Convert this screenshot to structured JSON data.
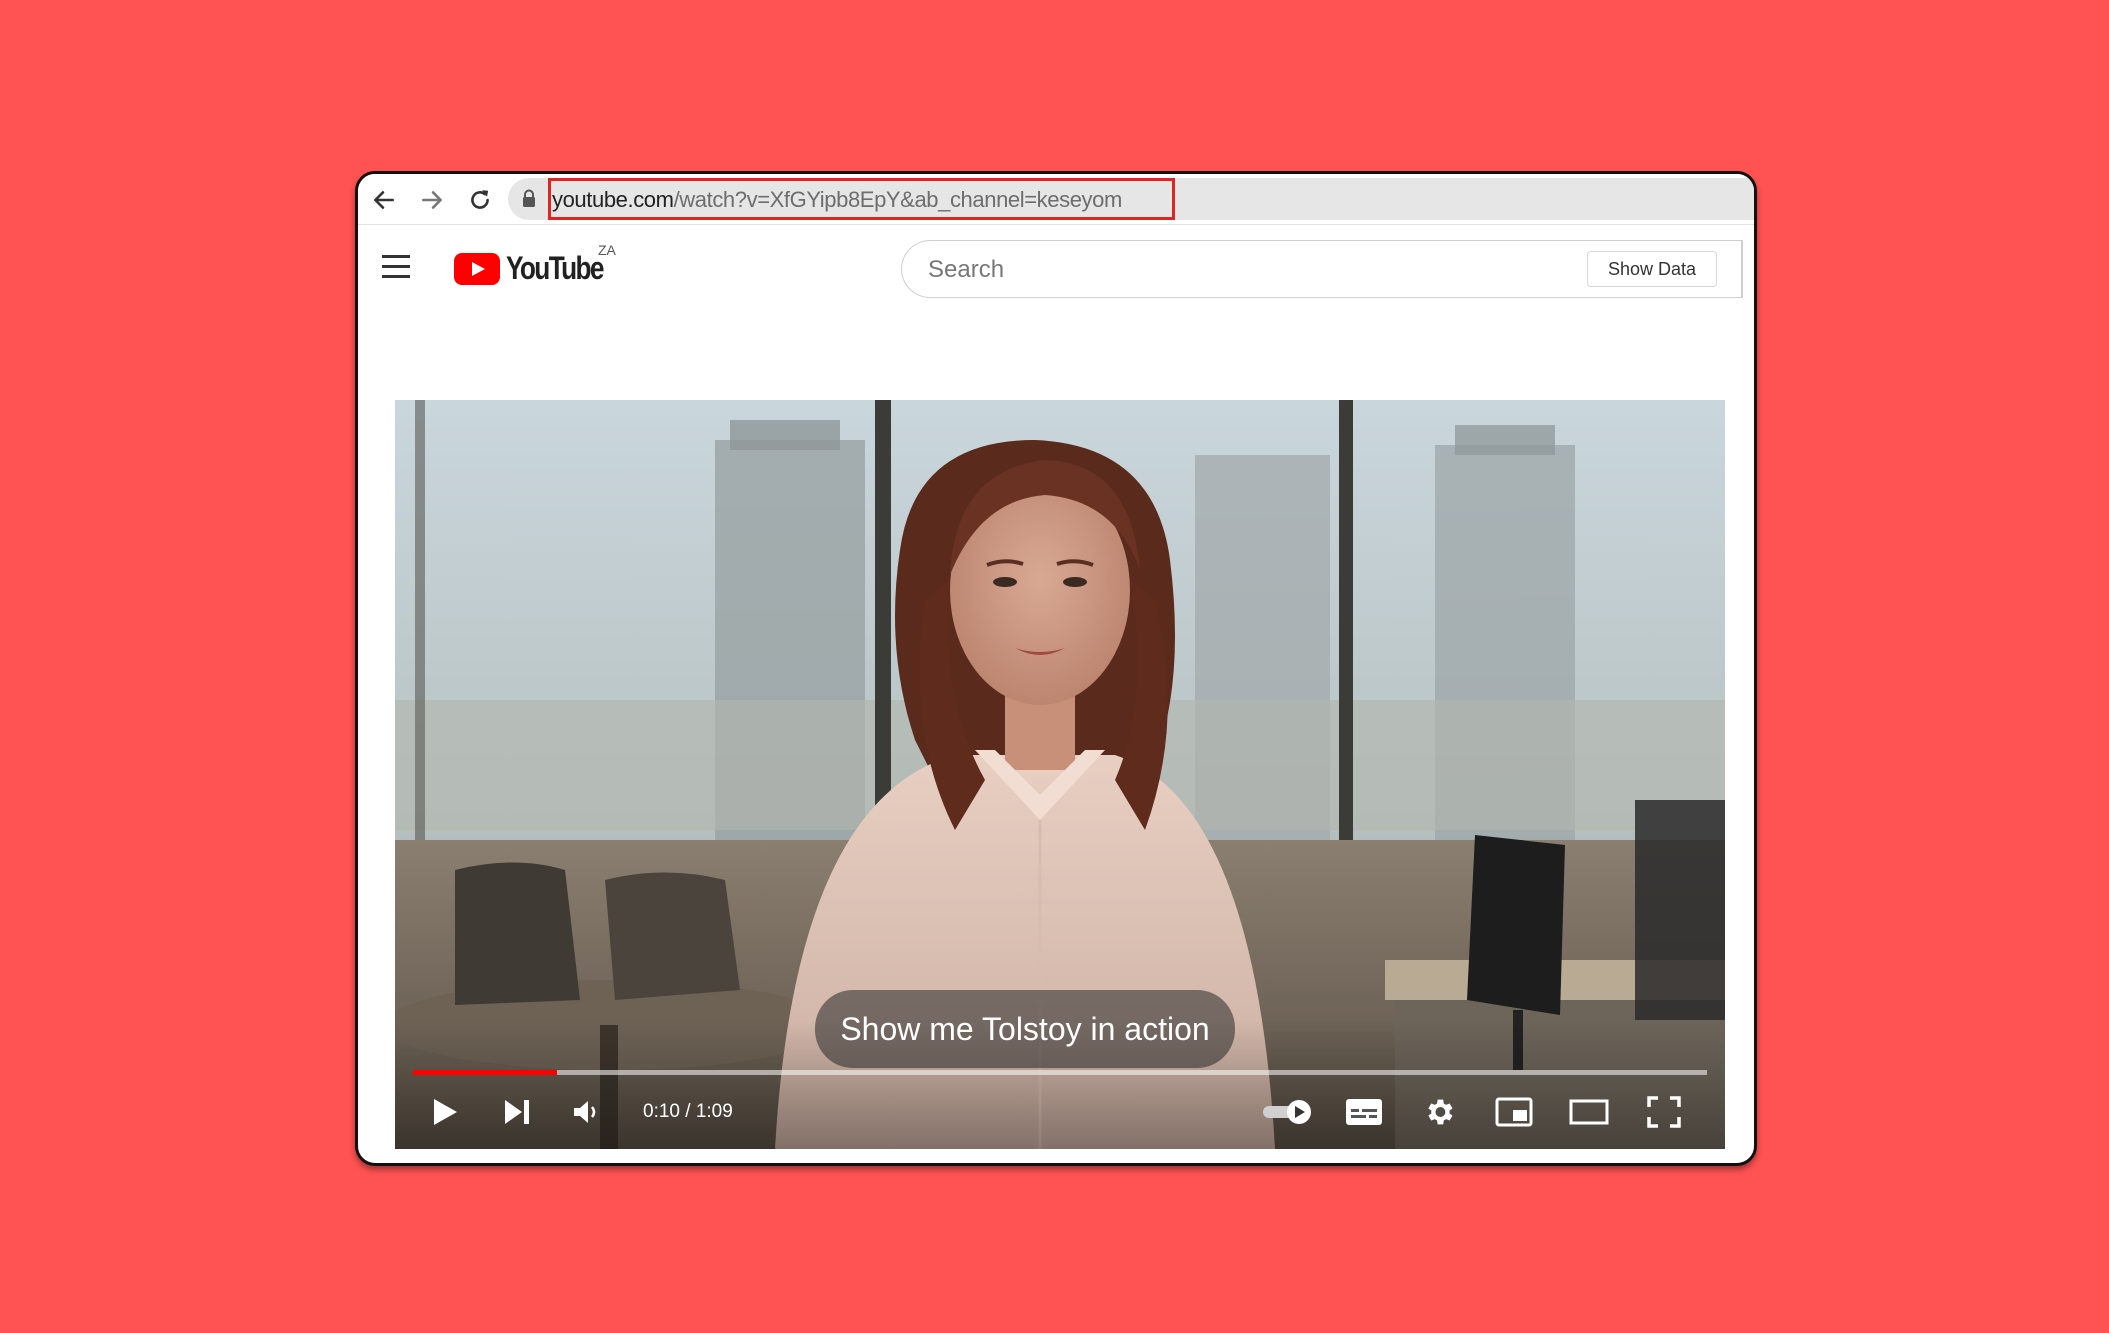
{
  "browser": {
    "url_domain": "youtube.com",
    "url_path": "/watch?v=XfGYipb8EpY&ab_channel=keseyom",
    "highlight_color": "#e02424"
  },
  "header": {
    "logo_text": "YouTube",
    "region": "ZA",
    "search_placeholder": "Search",
    "show_data_label": "Show Data"
  },
  "player": {
    "subtitle": "Show me Tolstoy in action",
    "time_display": "0:10 / 1:09",
    "progress_fraction": 0.111,
    "accent_color": "#ff0000"
  },
  "icons": {
    "nav": [
      "back-arrow-icon",
      "forward-arrow-icon",
      "reload-icon",
      "lock-icon"
    ],
    "controls": [
      "play-icon",
      "next-icon",
      "volume-icon",
      "autoplay-toggle-icon",
      "subtitles-icon",
      "settings-icon",
      "miniplayer-icon",
      "theater-mode-icon",
      "fullscreen-icon"
    ]
  }
}
